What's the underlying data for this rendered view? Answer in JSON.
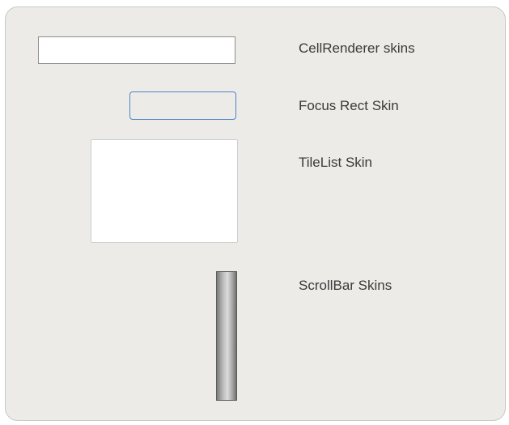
{
  "labels": {
    "cellrenderer": "CellRenderer skins",
    "focus_rect": "Focus Rect Skin",
    "tilelist": "TileList Skin",
    "scrollbar": "ScrollBar Skins"
  },
  "colors": {
    "panel_background": "#ecebe8",
    "focus_border": "#4f86c6",
    "label_text": "#3a3a3a"
  }
}
